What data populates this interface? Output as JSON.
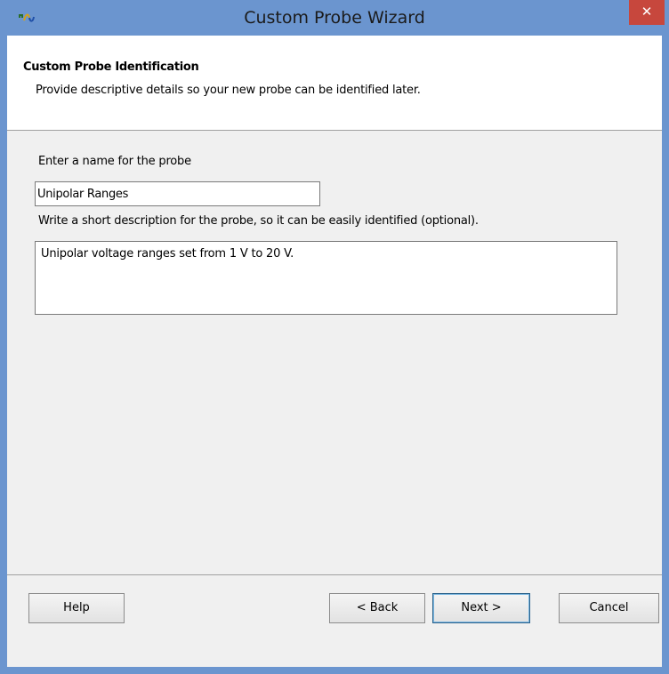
{
  "window": {
    "title": "Custom Probe Wizard",
    "close_glyph": "✕"
  },
  "header": {
    "title": "Custom Probe Identification",
    "subtitle": "Provide descriptive details so your new probe can be identified later."
  },
  "form": {
    "name_label": "Enter a name for the probe",
    "name_value": "Unipolar Ranges",
    "description_label": "Write a short description for the probe, so it can be easily identified (optional).",
    "description_value": "Unipolar voltage ranges set from 1 V to 20 V."
  },
  "buttons": {
    "help": "Help",
    "back": "< Back",
    "next": "Next >",
    "cancel": "Cancel"
  },
  "colors": {
    "titlebar": "#6b95cf",
    "close": "#c7473d",
    "client": "#f0f0f0",
    "header": "#ffffff"
  },
  "icons": {
    "app": "probe-wave-icon",
    "close": "close-icon"
  }
}
